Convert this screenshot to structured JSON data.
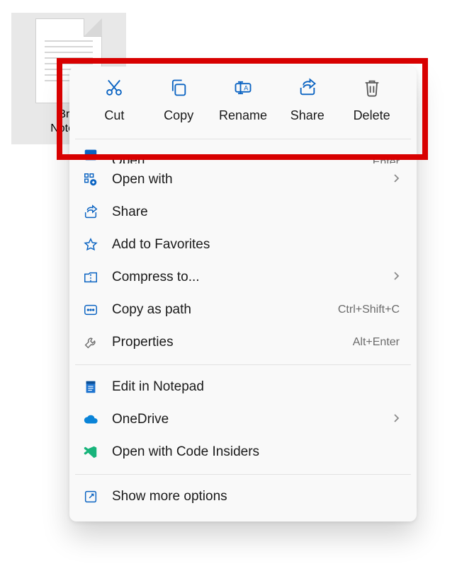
{
  "file": {
    "name_line1": "Br  n",
    "name_line2": "Notepa"
  },
  "quick": {
    "cut": "Cut",
    "copy": "Copy",
    "rename": "Rename",
    "share": "Share",
    "delete": "Delete"
  },
  "menu": {
    "open": {
      "label": "Open",
      "shortcut": "Enter"
    },
    "open_with": {
      "label": "Open with"
    },
    "share": {
      "label": "Share"
    },
    "favorites": {
      "label": "Add to Favorites"
    },
    "compress": {
      "label": "Compress to..."
    },
    "copy_path": {
      "label": "Copy as path",
      "shortcut": "Ctrl+Shift+C"
    },
    "properties": {
      "label": "Properties",
      "shortcut": "Alt+Enter"
    },
    "edit_notepad": {
      "label": "Edit in Notepad"
    },
    "onedrive": {
      "label": "OneDrive"
    },
    "code_insiders": {
      "label": "Open with Code Insiders"
    },
    "more": {
      "label": "Show more options"
    }
  },
  "colors": {
    "accent": "#0a63c2",
    "highlight": "#d80000"
  }
}
